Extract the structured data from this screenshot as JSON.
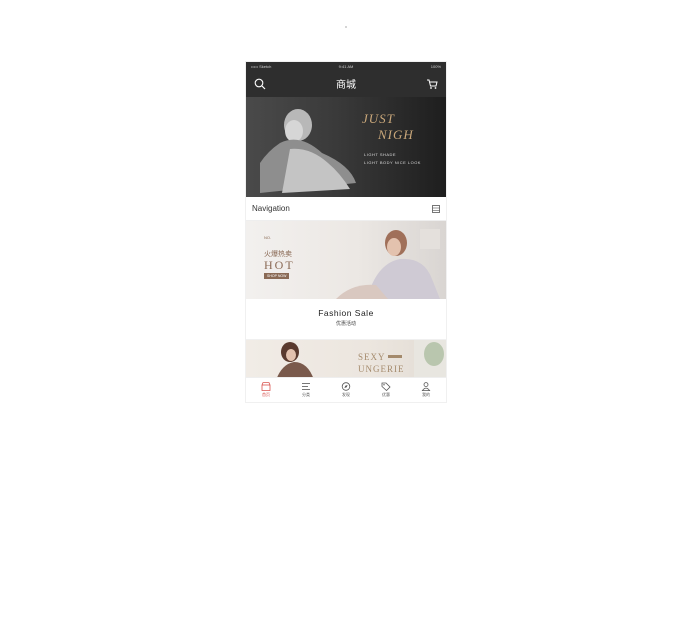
{
  "status_bar": {
    "carrier": "••••• Sketch",
    "time": "9:41 AM",
    "battery": "100%"
  },
  "header": {
    "title": "商城",
    "search_icon": "search-icon",
    "cart_icon": "cart-icon"
  },
  "hero": {
    "line1": "JUST",
    "line2": "NIGH",
    "sub1": "LIGHT SHADE",
    "sub2": "LIGHT BODY NICE LOOK"
  },
  "navigation": {
    "label": "Navigation",
    "icon": "grid-icon"
  },
  "promo": {
    "small": "NO.",
    "cn": "火爆热卖",
    "hot": "HOT",
    "button": "SHOP NOW"
  },
  "section": {
    "title": "Fashion  Sale",
    "subtitle": "优惠活动"
  },
  "lingerie": {
    "line1": "SEXY",
    "line2": "UNGERIE"
  },
  "tabbar": {
    "items": [
      {
        "label": "首页",
        "icon": "shop-icon",
        "active": true
      },
      {
        "label": "分类",
        "icon": "list-icon",
        "active": false
      },
      {
        "label": "发现",
        "icon": "compass-icon",
        "active": false
      },
      {
        "label": "优惠",
        "icon": "tag-icon",
        "active": false
      },
      {
        "label": "我的",
        "icon": "user-icon",
        "active": false
      }
    ]
  },
  "colors": {
    "header_bg": "#2e2e2e",
    "accent": "#d9534f",
    "gold": "#c9a77a"
  }
}
